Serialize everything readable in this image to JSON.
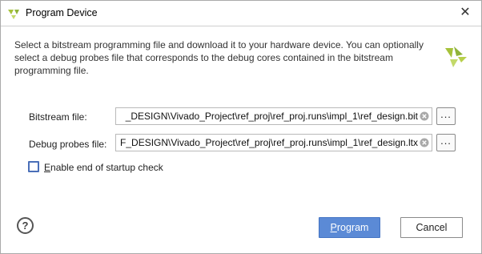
{
  "window": {
    "title": "Program Device",
    "close_glyph": "✕"
  },
  "description": "Select a bitstream programming file and download it to your hardware device. You can optionally select a debug probes file that corresponds to the debug cores contained in the bitstream programming file.",
  "form": {
    "bitstream_label": "Bitstream file:",
    "bitstream_value": "_DESIGN\\Vivado_Project\\ref_proj\\ref_proj.runs\\impl_1\\ref_design.bit",
    "debug_label": "Debug probes file:",
    "debug_value": "F_DESIGN\\Vivado_Project\\ref_proj\\ref_proj.runs\\impl_1\\ref_design.ltx",
    "browse_label": "...",
    "checkbox_mnemonic": "E",
    "checkbox_rest": "nable end of startup check",
    "checkbox_checked": false
  },
  "footer": {
    "help_label": "?",
    "program_mnemonic": "P",
    "program_rest": "rogram",
    "cancel_label": "Cancel"
  },
  "colors": {
    "accent": "#5b8ad6",
    "logo": "#a6c23a"
  },
  "icons": {
    "app": "vivado-logo-icon",
    "close": "close-icon",
    "clear": "clear-icon",
    "help": "help-icon"
  }
}
